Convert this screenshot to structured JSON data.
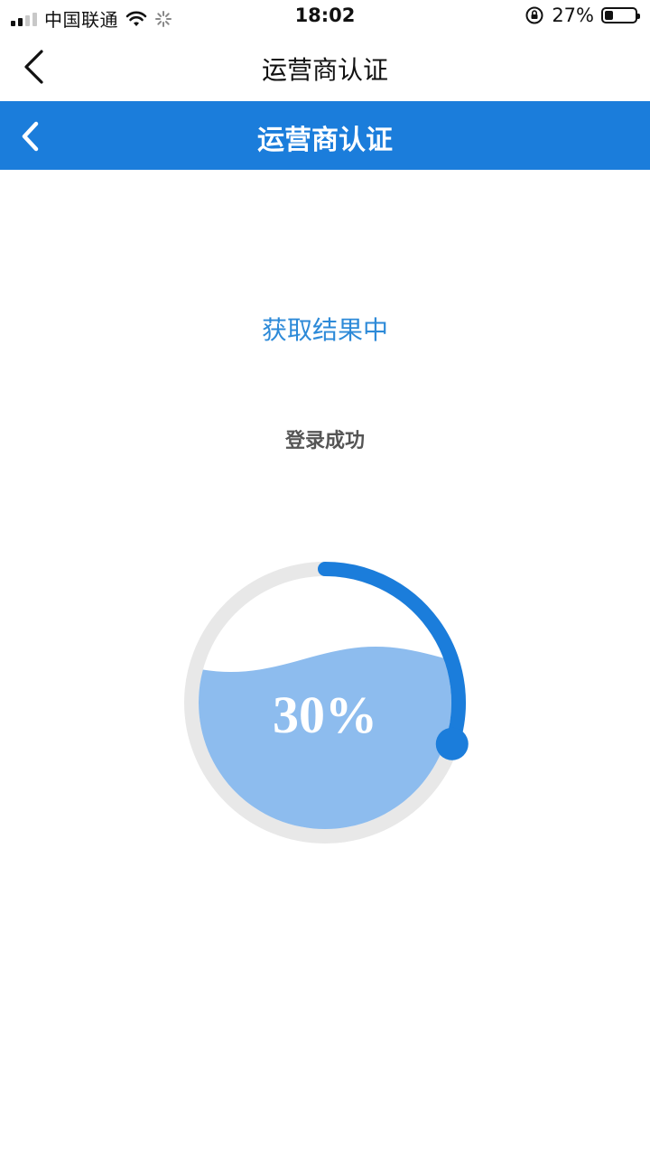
{
  "status_bar": {
    "carrier": "中国联通",
    "time": "18:02",
    "battery_percent": "27%",
    "battery_level": 0.27
  },
  "nav_white": {
    "title": "运营商认证",
    "back_icon": "chevron-left-icon"
  },
  "nav_blue": {
    "title": "运营商认证",
    "back_icon": "chevron-left-icon",
    "color": "#1b7ddb"
  },
  "content": {
    "status_message": "获取结果中",
    "sub_message": "登录成功"
  },
  "progress": {
    "value": 0.3,
    "label": "30%",
    "track_color": "#e8e8e8",
    "arc_color": "#1b7ddb",
    "water_color": "#8dbcee"
  }
}
